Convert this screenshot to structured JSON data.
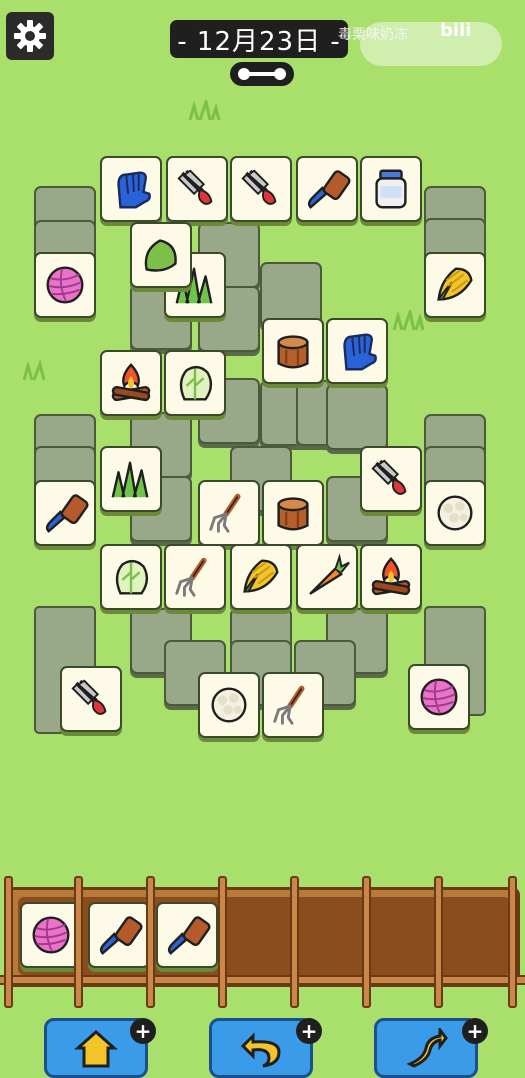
{
  "header": {
    "date_label": "- 12月23日 -",
    "watermark": "毒栗味奶冻",
    "brand": "bili"
  },
  "board": {
    "tiles": [
      "glove",
      "scissors",
      "scissors",
      "brush",
      "jar",
      "yarn",
      "corn",
      "grass",
      "leaf",
      "campfire",
      "cabbage",
      "stump",
      "glove",
      "grass",
      "brush",
      "fork",
      "stump",
      "cauliflower",
      "scissors",
      "cabbage",
      "fork",
      "corn",
      "carrot",
      "campfire",
      "scissors",
      "cauliflower",
      "fork",
      "yarn"
    ]
  },
  "tray": {
    "slots": [
      "yarn",
      "brush",
      "brush"
    ],
    "capacity": 7
  },
  "tools": [
    {
      "name": "shuffle-out",
      "count_label": "+"
    },
    {
      "name": "undo",
      "count_label": "+"
    },
    {
      "name": "shuffle",
      "count_label": "+"
    }
  ]
}
